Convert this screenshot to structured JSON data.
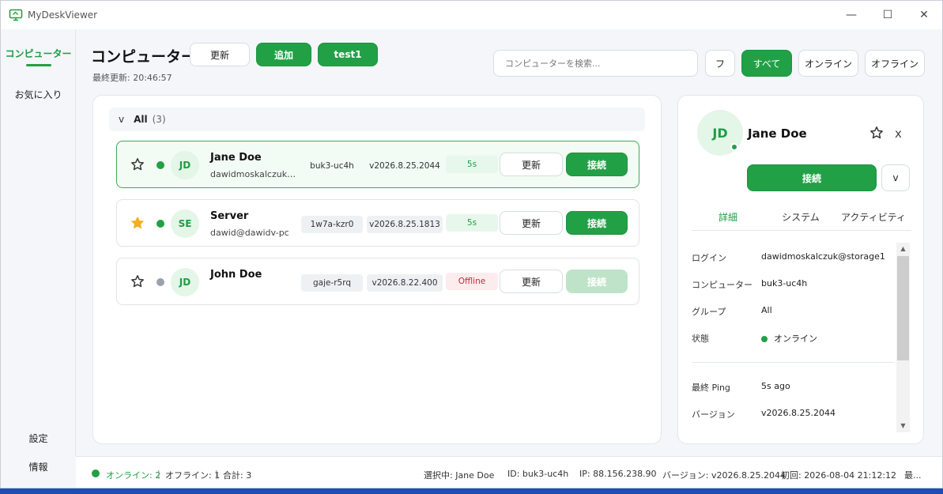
{
  "app": {
    "title": "MyDeskViewer"
  },
  "window_controls": {
    "minimize": "—",
    "maximize": "☐",
    "close": "✕"
  },
  "sidebar": {
    "items": [
      {
        "label": "コンピューター",
        "active": true
      },
      {
        "label": "お気に入り",
        "active": false
      }
    ],
    "bottom": [
      {
        "label": "設定"
      },
      {
        "label": "情報"
      }
    ]
  },
  "header": {
    "title": "コンピューター",
    "last_updated": "最終更新: 20:46:57",
    "buttons": {
      "refresh": "更新",
      "add": "追加",
      "test": "test1"
    },
    "search_placeholder": "コンピューターを検索...",
    "filters": {
      "f": "フ",
      "all": "すべて",
      "online": "オンライン",
      "offline": "オフライン"
    }
  },
  "group": {
    "chevron": "v",
    "name": "All",
    "count": "(3)"
  },
  "computers": [
    {
      "initials": "JD",
      "name": "Jane Doe",
      "sub": "dawidmoskalczuk@storage1",
      "id": "buk3-uc4h",
      "version": "v2026.8.25.2044",
      "ping": "5s",
      "online": true,
      "favorite": false,
      "selected": true
    },
    {
      "initials": "SE",
      "name": "Server",
      "sub": "dawid@dawidv-pc",
      "id": "1w7a-kzr0",
      "version": "v2026.8.25.1813",
      "ping": "5s",
      "online": true,
      "favorite": true,
      "selected": false
    },
    {
      "initials": "JD",
      "name": "John Doe",
      "sub": "",
      "id": "gaje-r5rq",
      "version": "v2026.8.22.400",
      "ping": "Offline",
      "online": false,
      "favorite": false,
      "selected": false
    }
  ],
  "row_buttons": {
    "refresh": "更新",
    "connect": "接続"
  },
  "detail": {
    "initials": "JD",
    "name": "Jane Doe",
    "close": "x",
    "connect": "接続",
    "more": "v",
    "tabs": [
      "詳細",
      "システム",
      "アクティビティ"
    ],
    "fields": [
      {
        "label": "ログイン",
        "value": "dawidmoskalczuk@storage1"
      },
      {
        "label": "コンピューター",
        "value": "buk3-uc4h"
      },
      {
        "label": "グループ",
        "value": "All"
      },
      {
        "label": "状態",
        "value": "オンライン"
      }
    ],
    "fields2": [
      {
        "label": "最終 Ping",
        "value": "5s ago"
      },
      {
        "label": "バージョン",
        "value": "v2026.8.25.2044"
      }
    ]
  },
  "statusbar": {
    "online": "オンライン: 2",
    "sep1": "|",
    "offline": "オフライン: 1",
    "sep2": "|",
    "total": "合計: 3",
    "selected": "選択中: Jane Doe",
    "id": "ID: buk3-uc4h",
    "ip": "IP: 88.156.238.90",
    "version": "バージョン: v2026.8.25.2044",
    "first": "初回: 2026-08-04 21:12:12",
    "more": "最..."
  },
  "colors": {
    "accent": "#22a046",
    "offline": "#c62839",
    "star": "#f2b01e"
  }
}
